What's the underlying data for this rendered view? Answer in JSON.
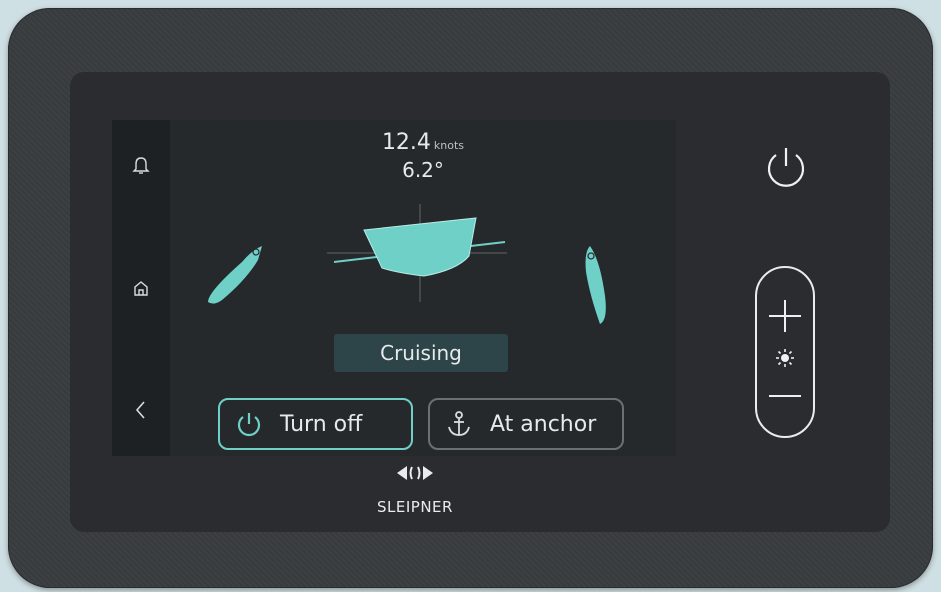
{
  "readout": {
    "speed_value": "12.4",
    "speed_unit": "knots",
    "angle": "6.2°"
  },
  "mode_label": "Cruising",
  "buttons": {
    "turn_off": "Turn off",
    "at_anchor": "At anchor"
  },
  "brand": "SLEIPNER",
  "colors": {
    "accent": "#6fd0c8",
    "screen_bg": "#25292c",
    "sidebar_bg": "#1e2124",
    "mode_bg": "#2d4549"
  },
  "icons": [
    "bell-icon",
    "home-icon",
    "back-chevron-icon",
    "power-icon",
    "anchor-icon",
    "plus-icon",
    "brightness-icon",
    "minus-icon",
    "sleipner-logo-icon"
  ]
}
